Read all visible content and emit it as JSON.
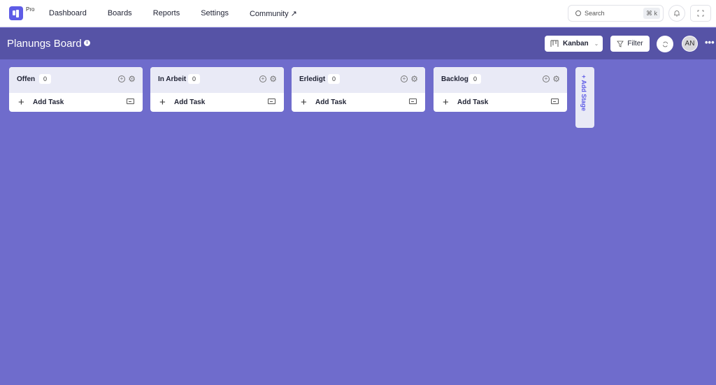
{
  "topnav": {
    "badge": "Pro",
    "links": [
      "Dashboard",
      "Boards",
      "Reports",
      "Settings",
      "Community ↗"
    ],
    "search": {
      "placeholder": "Search",
      "shortcut": "⌘ k"
    }
  },
  "board": {
    "title": "Planungs Board",
    "view": "Kanban",
    "filter_label": "Filter",
    "avatar_initials": "AN",
    "more": "•••"
  },
  "stages": [
    {
      "name": "Offen",
      "count": "0",
      "add_label": "Add Task"
    },
    {
      "name": "In Arbeit",
      "count": "0",
      "add_label": "Add Task"
    },
    {
      "name": "Erledigt",
      "count": "0",
      "add_label": "Add Task"
    },
    {
      "name": "Backlog",
      "count": "0",
      "add_label": "Add Task"
    }
  ],
  "add_stage_label": "+ Add Stage",
  "colors": {
    "accent": "#5e5ce6",
    "board_bg": "#6f6ccc",
    "board_bar": "#5653a6"
  }
}
